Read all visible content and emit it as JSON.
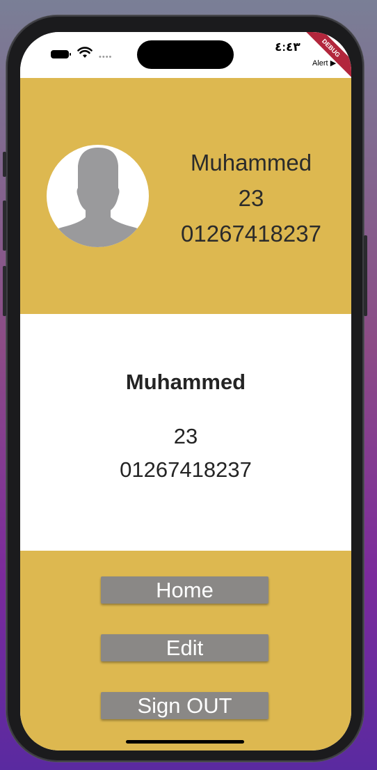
{
  "status_bar": {
    "time": "٤:٤٣",
    "back_label": "Alert",
    "debug_label": "DEBUG"
  },
  "profile_header": {
    "name": "Muhammed",
    "age": "23",
    "phone": "01267418237"
  },
  "profile_card": {
    "name": "Muhammed",
    "age": "23",
    "phone": "01267418237"
  },
  "actions": {
    "home_label": "Home",
    "edit_label": "Edit",
    "signout_label": "Sign OUT"
  },
  "colors": {
    "header_bg": "#ddb850",
    "button_bg": "#8a8886",
    "debug_banner": "#b2263c"
  }
}
